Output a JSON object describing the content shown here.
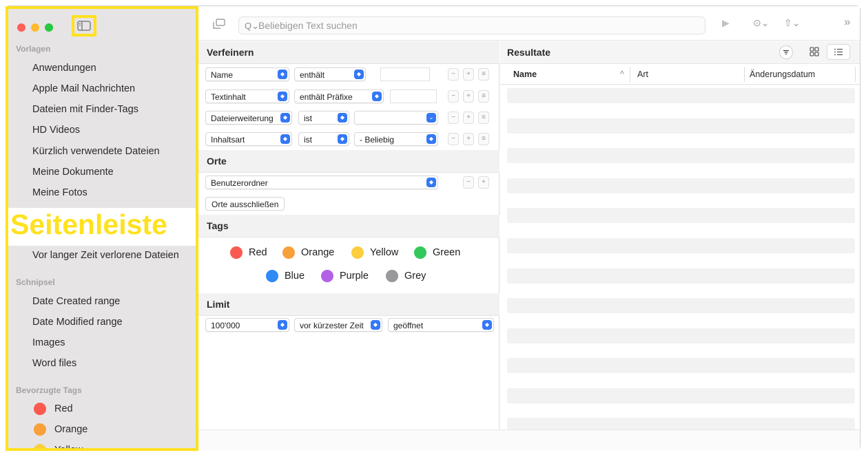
{
  "toolbar": {
    "search_placeholder": "Beliebigen Text suchen",
    "search_icon": "Q⌄",
    "run_icon": "▶",
    "more_icon": "⊙⌄",
    "share_icon": "⇧⌄",
    "overflow_icon": "»"
  },
  "sidebar": {
    "section_templates": "Vorlagen",
    "templates": [
      "Anwendungen",
      "Apple Mail Nachrichten",
      "Dateien mit Finder-Tags",
      "HD Videos",
      "Kürzlich verwendete Dateien",
      "Meine Dokumente",
      "Meine Fotos"
    ],
    "annotation": "Seitenleiste",
    "template_after": "Vor langer Zeit verlorene Dateien",
    "section_snippets": "Schnipsel",
    "snippets": [
      "Date Created range",
      "Date Modified range",
      "Images",
      "Word files"
    ],
    "section_tags": "Bevorzugte Tags",
    "tags": [
      {
        "label": "Red",
        "color": "#fb5a51"
      },
      {
        "label": "Orange",
        "color": "#f8a03a"
      },
      {
        "label": "Yellow",
        "color": "#fccd3f"
      }
    ]
  },
  "refine": {
    "header": "Verfeinern",
    "rows": [
      {
        "field": "Name",
        "op": "enthält",
        "value": ""
      },
      {
        "field": "Textinhalt",
        "op": "enthält Präfixe",
        "value": ""
      },
      {
        "field": "Dateierweiterung",
        "op": "ist",
        "value": ""
      },
      {
        "field": "Inhaltsart",
        "op": "ist",
        "value": "- Beliebig"
      }
    ],
    "btn_minus": "−",
    "btn_plus": "+",
    "btn_menu": "≡"
  },
  "places": {
    "header": "Orte",
    "location": "Benutzerordner",
    "exclude_button": "Orte ausschließen"
  },
  "tags": {
    "header": "Tags",
    "items": [
      {
        "label": "Red",
        "color": "#fb5a51"
      },
      {
        "label": "Orange",
        "color": "#f8a03a"
      },
      {
        "label": "Yellow",
        "color": "#fccd3f"
      },
      {
        "label": "Green",
        "color": "#32c85a"
      },
      {
        "label": "Blue",
        "color": "#2f8bf3"
      },
      {
        "label": "Purple",
        "color": "#b262e6"
      },
      {
        "label": "Grey",
        "color": "#98989d"
      }
    ]
  },
  "limit": {
    "header": "Limit",
    "count": "100'000",
    "order": "vor kürzester Zeit",
    "by": "geöffnet"
  },
  "results": {
    "header": "Resultate",
    "columns": [
      "Name",
      "Art",
      "Änderungsdatum"
    ],
    "sort_indicator": "^"
  },
  "colors": {
    "accent": "#3478f6",
    "annotation": "#ffe11f",
    "sidebar_bg": "#e7e4e5"
  }
}
